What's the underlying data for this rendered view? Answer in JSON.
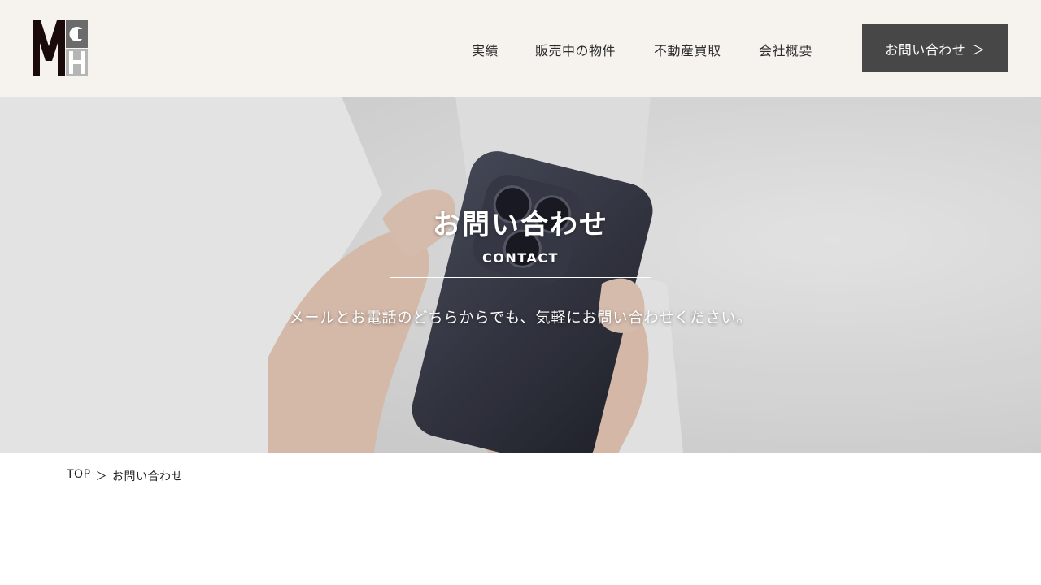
{
  "header": {
    "logo_text": "MCH",
    "nav": [
      {
        "label": "実績"
      },
      {
        "label": "販売中の物件"
      },
      {
        "label": "不動産買取"
      },
      {
        "label": "会社概要"
      }
    ],
    "contact_button": {
      "label": "お問い合わせ",
      "chevron": "＞"
    }
  },
  "hero": {
    "title": "お問い合わせ",
    "subtitle": "CONTACT",
    "description": "メールとお電話のどちらからでも、気軽にお問い合わせください。"
  },
  "breadcrumb": {
    "home": "TOP",
    "separator": "＞",
    "current": "お問い合わせ"
  },
  "colors": {
    "header_bg": "#f6f3ef",
    "button_bg": "#474747",
    "logo_dark": "#1a0a0a",
    "logo_gray": "#6b6b6b"
  }
}
